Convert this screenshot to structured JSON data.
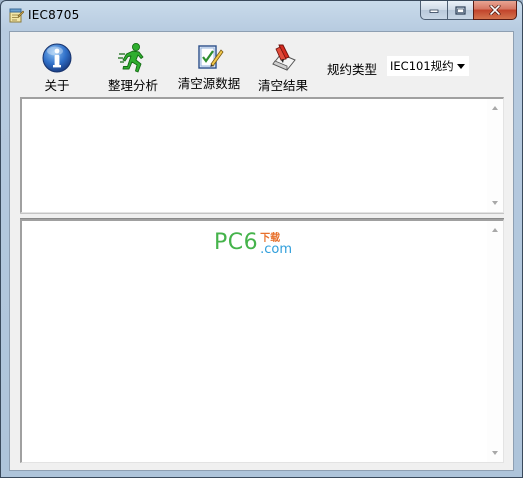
{
  "window": {
    "title": "IEC8705"
  },
  "toolbar": {
    "about_label": "关于",
    "analyze_label": "整理分析",
    "clear_source_label": "清空源数据",
    "clear_result_label": "清空结果",
    "protocol_label": "规约类型",
    "protocol_value": "IEC101规约"
  },
  "watermark": {
    "brand": "PC6",
    "sub_top": "下载",
    "sub_bottom": ".com"
  },
  "colors": {
    "watermark_green": "#45b34b",
    "watermark_orange": "#e8712d",
    "watermark_blue": "#2f9edb",
    "close_button_red": "#c2432b"
  },
  "icons": {
    "app": "notepad-icon",
    "about": "info-icon",
    "analyze": "running-man-icon",
    "clear_source": "checklist-pen-icon",
    "clear_result": "eraser-icon"
  }
}
